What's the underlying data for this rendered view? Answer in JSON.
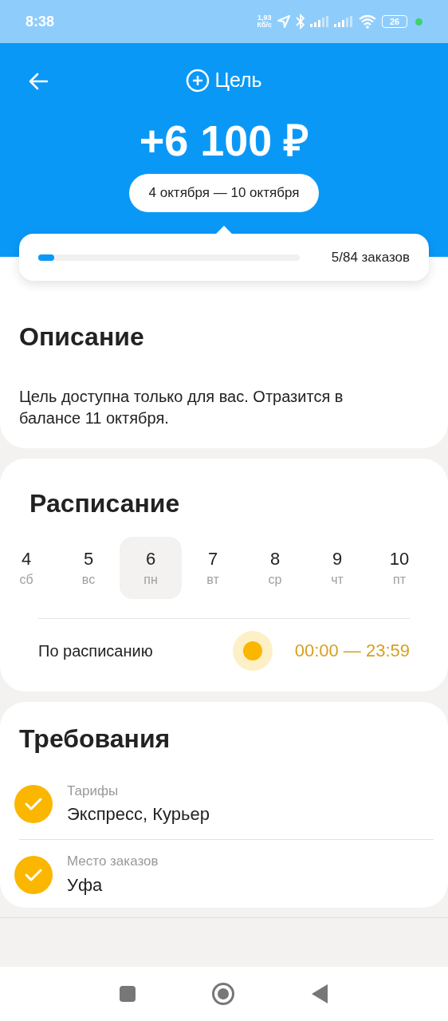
{
  "status_bar": {
    "time": "8:38",
    "speed_value": "1,93",
    "speed_unit": "Кб/с",
    "battery": "26"
  },
  "header": {
    "title": "Цель",
    "amount": "+6 100 ₽",
    "period": "4 октября — 10 октября"
  },
  "progress": {
    "level": 0.06,
    "label": "5/84 заказов"
  },
  "description": {
    "title": "Описание",
    "text": "Цель доступна только для вас. Отразится в балансе 11 октября."
  },
  "schedule": {
    "title": "Расписание",
    "days": [
      {
        "number": "4",
        "weekday": "сб",
        "selected": false
      },
      {
        "number": "5",
        "weekday": "вс",
        "selected": false
      },
      {
        "number": "6",
        "weekday": "пн",
        "selected": true
      },
      {
        "number": "7",
        "weekday": "вт",
        "selected": false
      },
      {
        "number": "8",
        "weekday": "ср",
        "selected": false
      },
      {
        "number": "9",
        "weekday": "чт",
        "selected": false
      },
      {
        "number": "10",
        "weekday": "пт",
        "selected": false
      }
    ],
    "row": {
      "label": "По расписанию",
      "time": "00:00 — 23:59"
    }
  },
  "requirements": {
    "title": "Требования",
    "items": [
      {
        "label": "Тарифы",
        "value": "Экспресс, Курьер",
        "checked": true
      },
      {
        "label": "Место заказов",
        "value": "Уфа",
        "checked": true
      }
    ]
  }
}
